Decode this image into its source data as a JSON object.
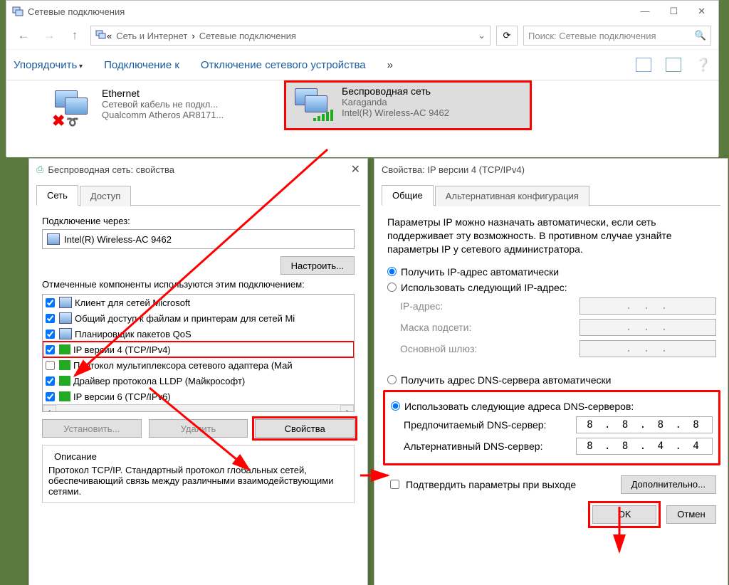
{
  "explorer": {
    "title": "Сетевые подключения",
    "breadcrumb": {
      "a": "Сеть и Интернет",
      "b": "Сетевые подключения"
    },
    "search_placeholder": "Поиск: Сетевые подключения",
    "toolbar": {
      "organize": "Упорядочить",
      "connect": "Подключение к",
      "disable": "Отключение сетевого устройства",
      "more": "»"
    },
    "eth": {
      "name": "Ethernet",
      "line2": "Сетевой кабель не подкл...",
      "line3": "Qualcomm Atheros AR8171..."
    },
    "wlan": {
      "name": "Беспроводная сеть",
      "line2": "Karaganda",
      "line3": "Intel(R) Wireless-AC 9462"
    }
  },
  "props": {
    "title": "Беспроводная сеть: свойства",
    "tab_network": "Сеть",
    "tab_access": "Доступ",
    "l_connect_via": "Подключение через:",
    "adapter": "Intel(R) Wireless-AC 9462",
    "configure": "Настроить...",
    "l_components": "Отмеченные компоненты используются этим подключением:",
    "items": {
      "i0": "Клиент для сетей Microsoft",
      "i1": "Общий доступ к файлам и принтерам для сетей Mi",
      "i2": "Планировщик пакетов QoS",
      "i3": "IP версии 4 (TCP/IPv4)",
      "i4": "Протокол мультиплексора сетевого адаптера (Май",
      "i5": "Драйвер протокола LLDP (Майкрософт)",
      "i6": "IP версии 6 (TCP/IPv6)"
    },
    "install": "Установить...",
    "remove": "Удалить",
    "properties": "Свойства",
    "desc_h": "Описание",
    "desc_b": "Протокол TCP/IP. Стандартный протокол глобальных сетей, обеспечивающий связь между различными взаимодействующими сетями."
  },
  "ipv4": {
    "title": "Свойства: IP версии 4 (TCP/IPv4)",
    "tab_general": "Общие",
    "tab_alt": "Альтернативная конфигурация",
    "info": "Параметры IP можно назначать автоматически, если сеть поддерживает эту возможность. В противном случае узнайте параметры IP у сетевого администратора.",
    "r_ip_auto": "Получить IP-адрес автоматически",
    "r_ip_manual": "Использовать следующий IP-адрес:",
    "f_ip": "IP-адрес:",
    "f_mask": "Маска подсети:",
    "f_gw": "Основной шлюз:",
    "r_dns_auto": "Получить адрес DNS-сервера автоматически",
    "r_dns_manual": "Использовать следующие адреса DNS-серверов:",
    "f_dns1": "Предпочитаемый DNS-сервер:",
    "f_dns2": "Альтернативный DNS-сервер:",
    "dns1_val": "8 . 8 . 8 . 8",
    "dns2_val": "8 . 8 . 4 . 4",
    "validate": "Подтвердить параметры при выходе",
    "advanced": "Дополнительно...",
    "ok": "OK",
    "cancel": "Отмен"
  },
  "dots": ".   .   ."
}
